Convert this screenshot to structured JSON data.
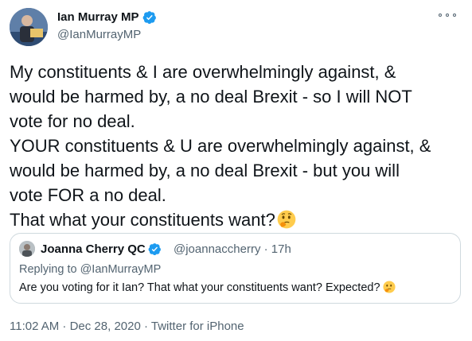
{
  "author": {
    "name": "Ian Murray MP",
    "handle": "@IanMurrayMP"
  },
  "tweet": {
    "lines": [
      "My constituents & I are overwhelmingly against, &",
      "would be harmed by, a no deal Brexit - so I will NOT",
      "vote for no deal.",
      "YOUR constituents & U are overwhelmingly against, &",
      "would be harmed by, a no deal Brexit - but you will",
      "vote FOR a no deal.",
      "That what your constituents want?"
    ],
    "emoji": "thinking-face-icon"
  },
  "quoted_tweet": {
    "name": "Joanna Cherry QC",
    "handle_time": "@joannaccherry · 17h",
    "replying_to": "Replying to @IanMurrayMP",
    "text": "Are you voting for it Ian? That what your constituents want? Expected?"
  },
  "meta": {
    "timestamp": "11:02 AM · Dec 28, 2020",
    "separator": " · ",
    "source": "Twitter for iPhone"
  },
  "colors": {
    "verified": "#1d9bf0",
    "secondary_text": "#536471",
    "border": "#cfd9de"
  }
}
